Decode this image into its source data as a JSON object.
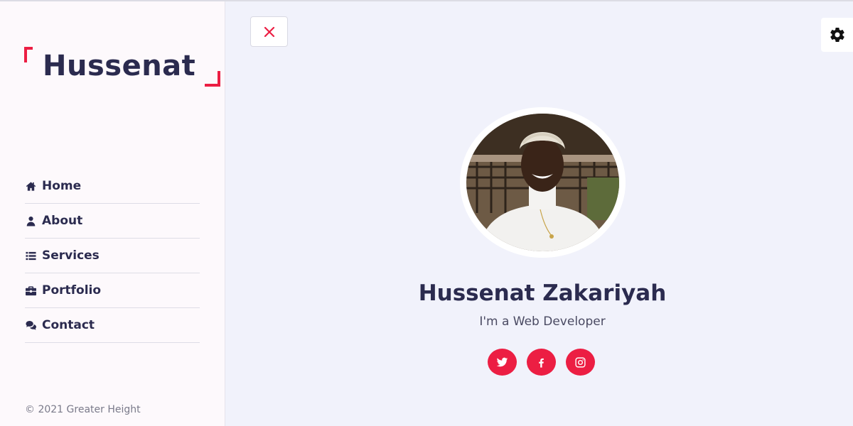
{
  "brand": {
    "logo_text": "Hussenat",
    "accent_color": "#ec1e43",
    "text_color": "#2b2b4f"
  },
  "sidebar": {
    "items": [
      {
        "label": "Home",
        "icon": "home-icon"
      },
      {
        "label": "About",
        "icon": "user-icon"
      },
      {
        "label": "Services",
        "icon": "list-icon"
      },
      {
        "label": "Portfolio",
        "icon": "briefcase-icon"
      },
      {
        "label": "Contact",
        "icon": "comments-icon"
      }
    ],
    "copyright": "© 2021 Greater Height"
  },
  "toolbar": {
    "close_icon": "close-icon",
    "settings_icon": "gear-icon"
  },
  "profile": {
    "name": "Hussenat Zakariyah",
    "role": "I'm a Web Developer",
    "photo": "profile-photo"
  },
  "socials": [
    {
      "network": "twitter",
      "icon": "twitter-icon"
    },
    {
      "network": "facebook",
      "icon": "facebook-icon"
    },
    {
      "network": "instagram",
      "icon": "instagram-icon"
    }
  ]
}
